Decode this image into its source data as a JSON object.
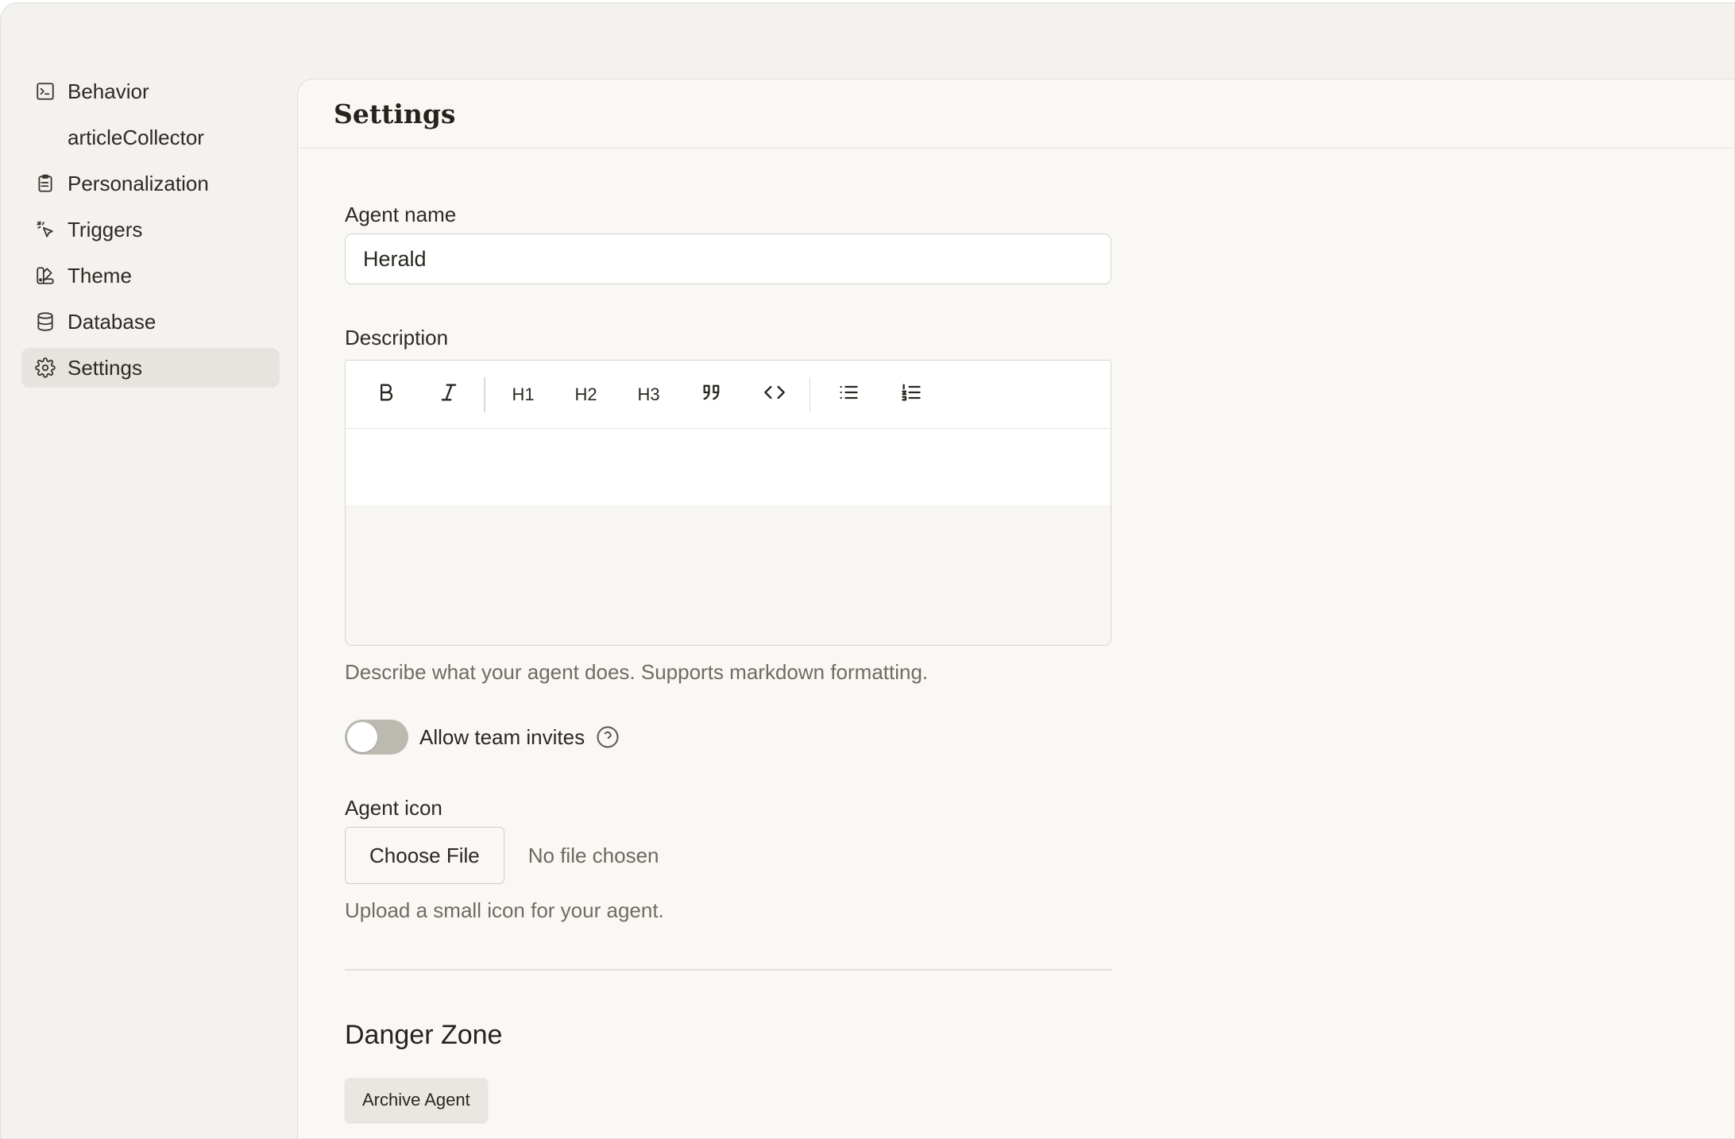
{
  "sidebar": {
    "items": [
      {
        "label": "Behavior",
        "icon": "terminal-square-icon"
      },
      {
        "label": "articleCollector",
        "icon": ""
      },
      {
        "label": "Personalization",
        "icon": "clipboard-list-icon"
      },
      {
        "label": "Triggers",
        "icon": "pointer-click-icon"
      },
      {
        "label": "Theme",
        "icon": "swatch-book-icon"
      },
      {
        "label": "Database",
        "icon": "database-icon"
      },
      {
        "label": "Settings",
        "icon": "gear-icon",
        "active": true
      }
    ]
  },
  "main": {
    "title": "Settings",
    "agent_name": {
      "label": "Agent name",
      "value": "Herald"
    },
    "description": {
      "label": "Description",
      "toolbar": [
        "bold-icon",
        "italic-icon",
        "H1",
        "H2",
        "H3",
        "quote-icon",
        "code-icon",
        "bullet-list-icon",
        "numbered-list-icon"
      ],
      "hint": "Describe what your agent does. Supports markdown formatting."
    },
    "team_invites": {
      "label": "Allow team invites",
      "enabled": false
    },
    "agent_icon": {
      "label": "Agent icon",
      "button": "Choose File",
      "status": "No file chosen",
      "hint": "Upload a small icon for your agent."
    },
    "danger_zone": {
      "title": "Danger Zone",
      "archive_button": "Archive Agent"
    }
  },
  "colors": {
    "background": "#f3f2ee",
    "panel": "#f9f8f5",
    "active_nav": "#e6e4df",
    "toggle_off": "#bcb9b1"
  }
}
